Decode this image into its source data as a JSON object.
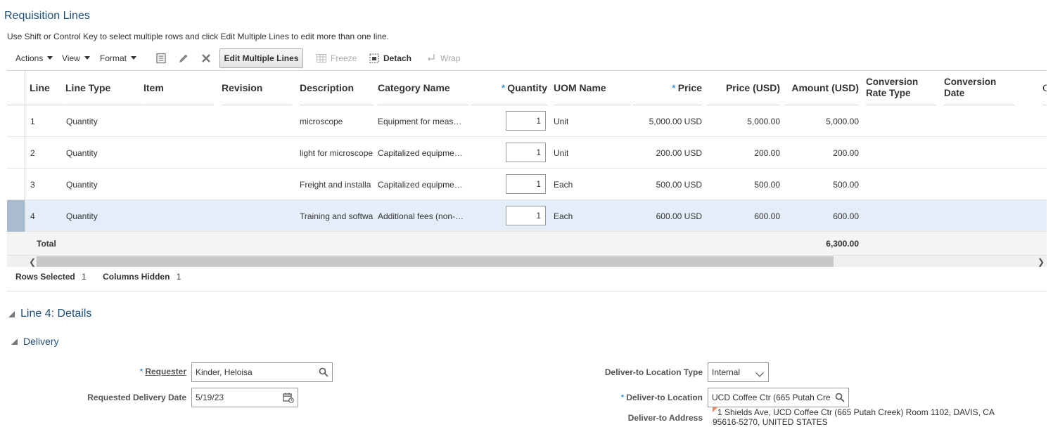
{
  "page": {
    "title": "Requisition Lines",
    "instruction": "Use Shift or Control Key to select multiple rows and click Edit Multiple Lines to edit more than one line."
  },
  "toolbar": {
    "actions_label": "Actions",
    "view_label": "View",
    "format_label": "Format",
    "edit_multiple_label": "Edit Multiple Lines",
    "freeze_label": "Freeze",
    "detach_label": "Detach",
    "wrap_label": "Wrap"
  },
  "table": {
    "headers": {
      "line": "Line",
      "line_type": "Line Type",
      "item": "Item",
      "revision": "Revision",
      "description": "Description",
      "category": "Category Name",
      "quantity": "Quantity",
      "uom": "UOM Name",
      "price": "Price",
      "price_usd": "Price (USD)",
      "amount_usd": "Amount (USD)",
      "conversion_rate_type": "Conversion Rate Type",
      "conversion_date": "Conversion Date",
      "cut": "C"
    },
    "required_mark": "*",
    "rows": [
      {
        "line": "1",
        "line_type": "Quantity",
        "description": "microscope",
        "category": "Equipment for meas…",
        "quantity": "1",
        "uom": "Unit",
        "price": "5,000.00 USD",
        "price_usd": "5,000.00",
        "amount_usd": "5,000.00"
      },
      {
        "line": "2",
        "line_type": "Quantity",
        "description": "light for microscope",
        "category": "Capitalized equipme…",
        "quantity": "1",
        "uom": "Unit",
        "price": "200.00 USD",
        "price_usd": "200.00",
        "amount_usd": "200.00"
      },
      {
        "line": "3",
        "line_type": "Quantity",
        "description": "Freight and installa",
        "category": "Capitalized equipme…",
        "quantity": "1",
        "uom": "Each",
        "price": "500.00 USD",
        "price_usd": "500.00",
        "amount_usd": "500.00"
      },
      {
        "line": "4",
        "line_type": "Quantity",
        "description": "Training and softwa",
        "category": "Additional fees (non-…",
        "quantity": "1",
        "uom": "Each",
        "price": "600.00 USD",
        "price_usd": "600.00",
        "amount_usd": "600.00"
      }
    ],
    "total_label": "Total",
    "total_amount": "6,300.00"
  },
  "status": {
    "rows_selected_label": "Rows Selected",
    "rows_selected_value": "1",
    "columns_hidden_label": "Columns Hidden",
    "columns_hidden_value": "1"
  },
  "details": {
    "title": "Line 4: Details",
    "delivery_title": "Delivery",
    "requester_label": "Requester",
    "requester_value": "Kinder, Heloisa",
    "delivery_date_label": "Requested Delivery Date",
    "delivery_date_value": "5/19/23",
    "location_type_label": "Deliver-to Location Type",
    "location_type_value": "Internal",
    "location_label": "Deliver-to Location",
    "location_value": "UCD Coffee Ctr (665 Putah Cre",
    "address_label": "Deliver-to Address",
    "address_line1": "1 Shields Ave, UCD Coffee Ctr (665 Putah Creek) Room 1102, DAVIS, CA",
    "address_line2": "95616-5270, UNITED STATES"
  },
  "colors": {
    "title": "#1f4e79",
    "required": "#0572ce",
    "selected_row": "#e4eef8",
    "selected_marker": "#a9bccf"
  }
}
